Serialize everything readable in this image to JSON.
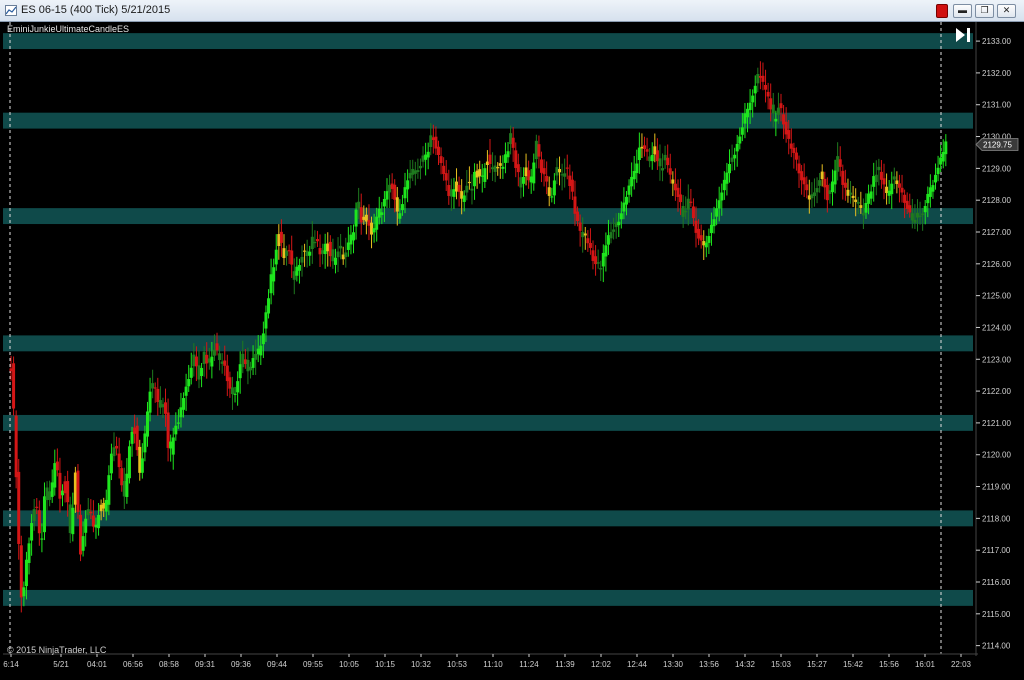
{
  "window": {
    "title": "ES 06-15 (400 Tick)  5/21/2015",
    "minimize_glyph": "▬",
    "maximize_glyph": "❐",
    "close_glyph": "✕"
  },
  "chart": {
    "indicator_label": "EminiJunkieUltimateCandleES",
    "copyright": "© 2015 NinjaTrader, LLC",
    "scroll_to_end_icon": "skip-to-end-icon",
    "last_price_label": "2129.75",
    "colors": {
      "background": "#000000",
      "zone": "#0f4a4a",
      "bull_bright": "#1ee61e",
      "bull_dark": "#1f7a1f",
      "neutral": "#e8c020",
      "bear": "#d41616",
      "axis_text": "#d0d0d0"
    }
  },
  "chart_data": {
    "type": "candlestick",
    "instrument": "ES 06-15",
    "bar_type": "400 Tick",
    "date": "5/21/2015",
    "ylim": [
      2113.8,
      2133.6
    ],
    "y_ticks": [
      "2114.00",
      "2115.00",
      "2116.00",
      "2117.00",
      "2118.00",
      "2119.00",
      "2120.00",
      "2121.00",
      "2122.00",
      "2123.00",
      "2124.00",
      "2125.00",
      "2126.00",
      "2127.00",
      "2128.00",
      "2129.00",
      "2130.00",
      "2131.00",
      "2132.00",
      "2133.00"
    ],
    "x_ticks": [
      "6:14",
      "5/21",
      "04:01",
      "06:56",
      "08:58",
      "09:31",
      "09:36",
      "09:44",
      "09:55",
      "10:05",
      "10:15",
      "10:32",
      "10:53",
      "11:10",
      "11:24",
      "11:39",
      "12:02",
      "12:44",
      "13:30",
      "13:56",
      "14:32",
      "15:03",
      "15:27",
      "15:42",
      "15:56",
      "16:01",
      "22:03"
    ],
    "zones": [
      {
        "low": 2132.75,
        "high": 2133.25
      },
      {
        "low": 2130.25,
        "high": 2130.75
      },
      {
        "low": 2127.25,
        "high": 2127.75
      },
      {
        "low": 2123.25,
        "high": 2123.75
      },
      {
        "low": 2120.75,
        "high": 2121.25
      },
      {
        "low": 2117.75,
        "high": 2118.25
      },
      {
        "low": 2115.25,
        "high": 2115.75
      }
    ],
    "session_markers": [
      "6:14",
      "16:01"
    ],
    "last_price": 2129.75,
    "close_path": [
      [
        0,
        2122.8
      ],
      [
        4,
        2120.5
      ],
      [
        8,
        2117.0
      ],
      [
        11,
        2115.2
      ],
      [
        15,
        2116.5
      ],
      [
        20,
        2117.8
      ],
      [
        25,
        2118.5
      ],
      [
        30,
        2117.0
      ],
      [
        35,
        2119.0
      ],
      [
        40,
        2118.5
      ],
      [
        45,
        2120.0
      ],
      [
        50,
        2118.5
      ],
      [
        55,
        2119.2
      ],
      [
        60,
        2117.5
      ],
      [
        65,
        2119.5
      ],
      [
        70,
        2117.0
      ],
      [
        75,
        2118.0
      ],
      [
        80,
        2118.2
      ],
      [
        85,
        2117.6
      ],
      [
        90,
        2118.5
      ],
      [
        95,
        2118.0
      ],
      [
        100,
        2119.8
      ],
      [
        105,
        2120.3
      ],
      [
        110,
        2119.5
      ],
      [
        115,
        2118.5
      ],
      [
        120,
        2120.5
      ],
      [
        125,
        2121.0
      ],
      [
        130,
        2119.5
      ],
      [
        135,
        2120.5
      ],
      [
        140,
        2122.0
      ],
      [
        145,
        2122.2
      ],
      [
        150,
        2121.5
      ],
      [
        155,
        2121.8
      ],
      [
        160,
        2119.8
      ],
      [
        165,
        2121.0
      ],
      [
        170,
        2121.2
      ],
      [
        175,
        2122.0
      ],
      [
        180,
        2122.5
      ],
      [
        185,
        2123.2
      ],
      [
        190,
        2122.5
      ],
      [
        195,
        2123.2
      ],
      [
        200,
        2122.8
      ],
      [
        205,
        2123.5
      ],
      [
        210,
        2123.0
      ],
      [
        215,
        2123.0
      ],
      [
        220,
        2122.2
      ],
      [
        225,
        2121.8
      ],
      [
        230,
        2122.5
      ],
      [
        235,
        2123.2
      ],
      [
        240,
        2122.5
      ],
      [
        245,
        2123.0
      ],
      [
        250,
        2123.2
      ],
      [
        255,
        2124.0
      ],
      [
        260,
        2125.0
      ],
      [
        265,
        2126.0
      ],
      [
        270,
        2127.0
      ],
      [
        275,
        2126.2
      ],
      [
        280,
        2126.5
      ],
      [
        285,
        2125.5
      ],
      [
        290,
        2126.0
      ],
      [
        295,
        2126.5
      ],
      [
        300,
        2126.2
      ],
      [
        305,
        2126.8
      ],
      [
        310,
        2126.5
      ],
      [
        315,
        2126.2
      ],
      [
        320,
        2126.8
      ],
      [
        325,
        2126.0
      ],
      [
        330,
        2126.5
      ],
      [
        335,
        2126.2
      ],
      [
        340,
        2126.5
      ],
      [
        345,
        2127.0
      ],
      [
        350,
        2128.0
      ],
      [
        355,
        2127.2
      ],
      [
        360,
        2127.5
      ],
      [
        365,
        2126.8
      ],
      [
        370,
        2127.5
      ],
      [
        375,
        2127.8
      ],
      [
        380,
        2128.2
      ],
      [
        385,
        2128.5
      ],
      [
        390,
        2127.5
      ],
      [
        395,
        2128.0
      ],
      [
        400,
        2128.6
      ],
      [
        405,
        2128.8
      ],
      [
        410,
        2129.0
      ],
      [
        415,
        2129.2
      ],
      [
        420,
        2129.5
      ],
      [
        425,
        2130.2
      ],
      [
        430,
        2129.5
      ],
      [
        435,
        2129.0
      ],
      [
        440,
        2128.5
      ],
      [
        445,
        2128.0
      ],
      [
        450,
        2128.5
      ],
      [
        455,
        2128.0
      ],
      [
        460,
        2128.5
      ],
      [
        465,
        2128.3
      ],
      [
        470,
        2129.0
      ],
      [
        475,
        2128.5
      ],
      [
        480,
        2129.5
      ],
      [
        485,
        2128.8
      ],
      [
        490,
        2129.2
      ],
      [
        495,
        2129.0
      ],
      [
        500,
        2129.5
      ],
      [
        505,
        2130.0
      ],
      [
        510,
        2129.0
      ],
      [
        515,
        2128.5
      ],
      [
        520,
        2129.0
      ],
      [
        525,
        2128.5
      ],
      [
        530,
        2129.8
      ],
      [
        535,
        2129.0
      ],
      [
        540,
        2128.5
      ],
      [
        545,
        2128.0
      ],
      [
        550,
        2129.0
      ],
      [
        555,
        2128.7
      ],
      [
        560,
        2129.0
      ],
      [
        565,
        2128.5
      ],
      [
        570,
        2127.5
      ],
      [
        575,
        2127.0
      ],
      [
        580,
        2126.8
      ],
      [
        585,
        2126.5
      ],
      [
        590,
        2126.0
      ],
      [
        595,
        2125.8
      ],
      [
        600,
        2126.5
      ],
      [
        605,
        2127.0
      ],
      [
        610,
        2127.2
      ],
      [
        615,
        2127.5
      ],
      [
        620,
        2128.0
      ],
      [
        625,
        2128.5
      ],
      [
        630,
        2129.0
      ],
      [
        635,
        2129.8
      ],
      [
        640,
        2129.5
      ],
      [
        645,
        2129.2
      ],
      [
        650,
        2129.6
      ],
      [
        655,
        2129.0
      ],
      [
        660,
        2129.3
      ],
      [
        665,
        2128.7
      ],
      [
        670,
        2128.5
      ],
      [
        675,
        2128.0
      ],
      [
        680,
        2127.5
      ],
      [
        685,
        2128.0
      ],
      [
        690,
        2127.3
      ],
      [
        695,
        2126.8
      ],
      [
        700,
        2126.5
      ],
      [
        705,
        2127.0
      ],
      [
        710,
        2127.5
      ],
      [
        715,
        2128.0
      ],
      [
        720,
        2128.5
      ],
      [
        725,
        2129.2
      ],
      [
        730,
        2129.5
      ],
      [
        735,
        2130.0
      ],
      [
        740,
        2130.5
      ],
      [
        745,
        2131.0
      ],
      [
        750,
        2131.5
      ],
      [
        755,
        2132.0
      ],
      [
        760,
        2131.5
      ],
      [
        765,
        2131.2
      ],
      [
        770,
        2130.5
      ],
      [
        775,
        2131.0
      ],
      [
        780,
        2130.5
      ],
      [
        785,
        2129.8
      ],
      [
        790,
        2129.5
      ],
      [
        795,
        2129.0
      ],
      [
        800,
        2128.5
      ],
      [
        805,
        2128.0
      ],
      [
        810,
        2128.2
      ],
      [
        815,
        2128.5
      ],
      [
        820,
        2128.8
      ],
      [
        825,
        2128.0
      ],
      [
        830,
        2128.5
      ],
      [
        835,
        2129.3
      ],
      [
        840,
        2128.5
      ],
      [
        845,
        2128.2
      ],
      [
        850,
        2128.0
      ],
      [
        855,
        2127.8
      ],
      [
        860,
        2127.5
      ],
      [
        865,
        2128.0
      ],
      [
        870,
        2128.5
      ],
      [
        875,
        2129.0
      ],
      [
        880,
        2128.5
      ],
      [
        885,
        2128.0
      ],
      [
        890,
        2128.7
      ],
      [
        895,
        2128.5
      ],
      [
        900,
        2128.2
      ],
      [
        905,
        2127.8
      ],
      [
        910,
        2127.3
      ],
      [
        915,
        2127.5
      ],
      [
        920,
        2127.6
      ],
      [
        925,
        2128.0
      ],
      [
        930,
        2128.5
      ],
      [
        935,
        2129.0
      ],
      [
        940,
        2129.3
      ],
      [
        945,
        2130.2
      ]
    ]
  }
}
